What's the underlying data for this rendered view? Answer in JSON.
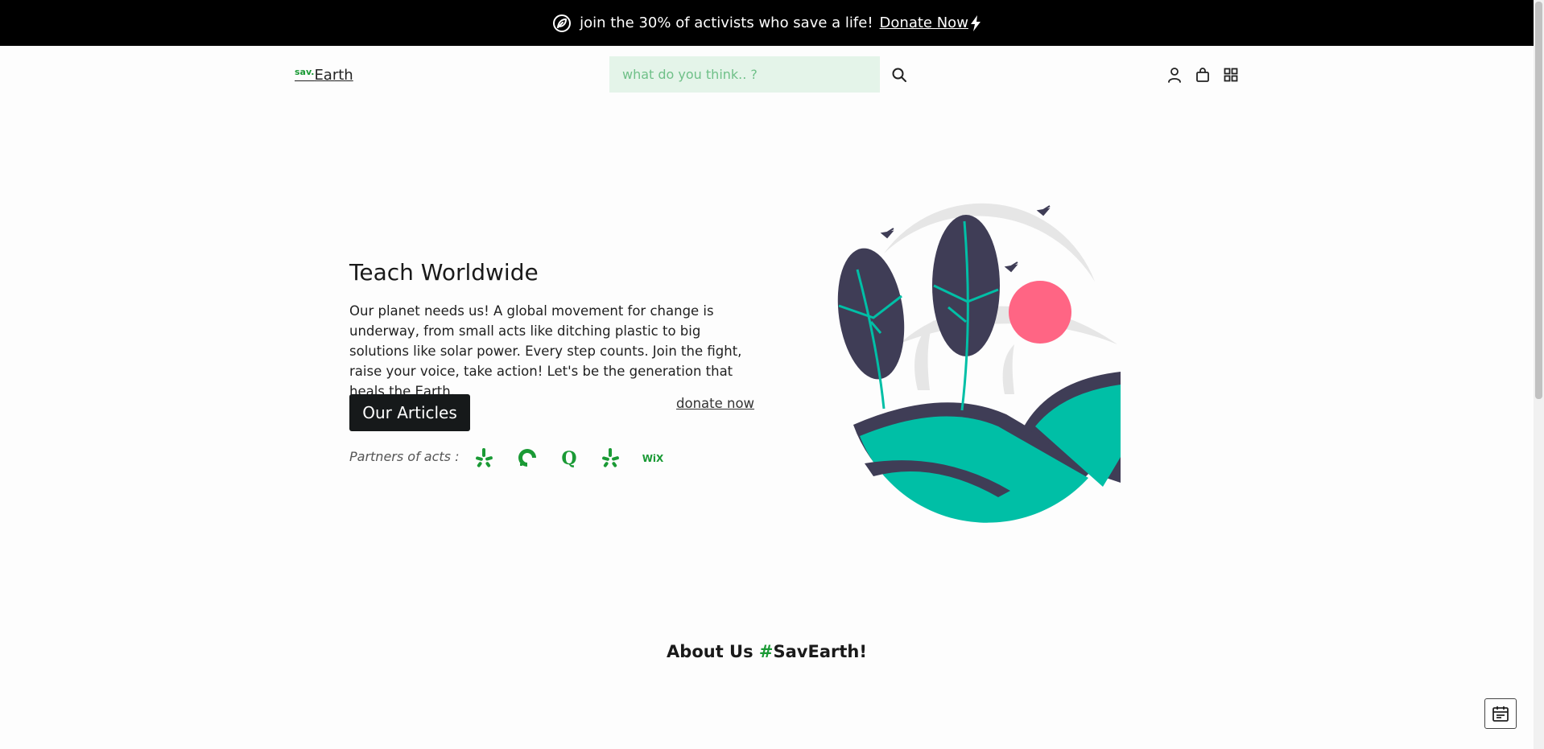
{
  "announcement": {
    "icon": "leaf-icon",
    "text": "join the 30% of activists who save a life!",
    "link_label": "Donate Now",
    "link_icon": "lightning-icon"
  },
  "header": {
    "logo_prefix": "sav.",
    "logo_main": "Earth",
    "search_placeholder": "what do you think.. ?",
    "search_icon": "search-icon",
    "icons": [
      "user-icon",
      "bag-icon",
      "grid-icon"
    ]
  },
  "hero": {
    "title": "Teach Worldwide",
    "description": "Our planet needs us! A global movement for change is underway, from small acts like ditching plastic to big solutions like solar power. Every step counts. Join the fight, raise your voice, take action! Let's be the generation that heals the Earth.",
    "primary_button": "Our Articles",
    "secondary_link": "donate now",
    "partners_label": "Partners of acts :",
    "partner_logos": [
      "yelp-icon",
      "digitalocean-icon",
      "quora-icon",
      "yelp-icon",
      "wix-icon"
    ]
  },
  "about": {
    "prefix": "About Us ",
    "hash": "#",
    "tag": "SavEarth!"
  },
  "floating_button": {
    "icon": "calendar-icon"
  },
  "colors": {
    "accent": "#1a9a35",
    "topbar_bg": "#000000",
    "search_bg": "#e4f4e9",
    "button_bg": "#16191a",
    "teal": "#00bfa6",
    "navy": "#3f3d56",
    "sun": "#ff6584"
  }
}
